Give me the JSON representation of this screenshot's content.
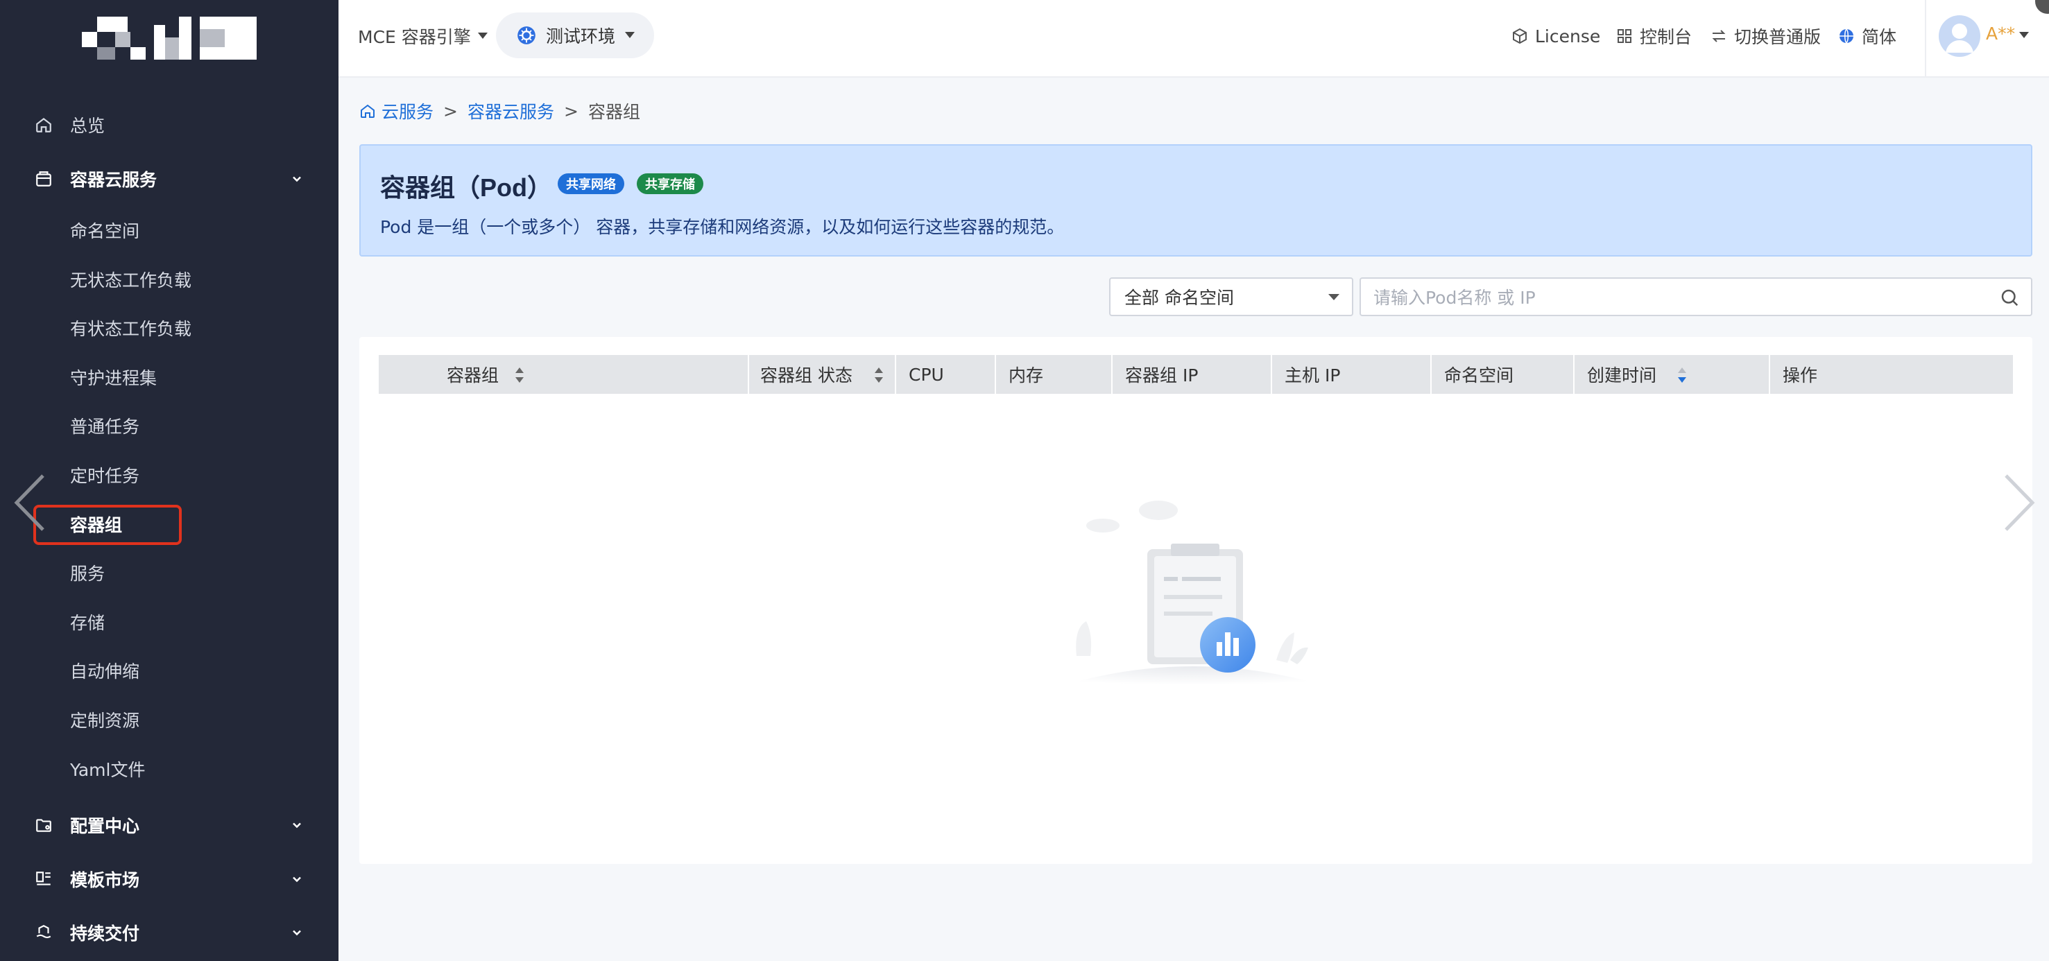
{
  "sidebar": {
    "items": [
      {
        "label": "总览",
        "icon": "home-icon"
      },
      {
        "label": "容器云服务",
        "icon": "box-icon"
      },
      {
        "label": "命名空间"
      },
      {
        "label": "无状态工作负载"
      },
      {
        "label": "有状态工作负载"
      },
      {
        "label": "守护进程集"
      },
      {
        "label": "普通任务"
      },
      {
        "label": "定时任务"
      },
      {
        "label": "容器组"
      },
      {
        "label": "服务"
      },
      {
        "label": "存储"
      },
      {
        "label": "自动伸缩"
      },
      {
        "label": "定制资源"
      },
      {
        "label": "Yaml文件"
      },
      {
        "label": "配置中心",
        "icon": "folder-settings-icon"
      },
      {
        "label": "模板市场",
        "icon": "template-icon"
      },
      {
        "label": "持续交付",
        "icon": "delivery-icon"
      }
    ],
    "active": "容器组"
  },
  "header": {
    "engine_label": "MCE 容器引擎",
    "env_label": "测试环境",
    "license_label": "License",
    "console_label": "控制台",
    "switch_label": "切换普通版",
    "lang_label": "简体",
    "user_name": "A**"
  },
  "breadcrumb": {
    "root": "云服务",
    "sep": ">",
    "parent": "容器云服务",
    "current": "容器组"
  },
  "banner": {
    "title": "容器组（Pod）",
    "tag_network": "共享网络",
    "tag_storage": "共享存储",
    "description": "Pod 是一组（一个或多个） 容器，共享存储和网络资源，以及如何运行这些容器的规范。"
  },
  "filters": {
    "namespace_select": "全部 命名空间",
    "search_placeholder": "请输入Pod名称 或 IP"
  },
  "table": {
    "columns": [
      "容器组",
      "容器组 状态",
      "CPU",
      "内存",
      "容器组 IP",
      "主机 IP",
      "命名空间",
      "创建时间",
      "操作"
    ]
  },
  "colors": {
    "sidebar_bg": "#232838",
    "accent": "#1f6fd8",
    "active_outline": "#e0321d",
    "banner_bg": "#cfe3ff",
    "tag_storage": "#1d8a4a"
  }
}
